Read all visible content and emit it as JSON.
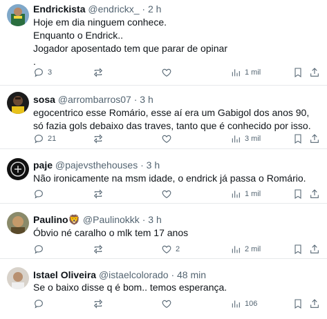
{
  "tweets": [
    {
      "name": "Endrickista",
      "handle": "@endrickx_",
      "sep": "·",
      "time": "2 h",
      "lines": [
        "Hoje em dia ninguem conhece.",
        "Enquanto o Endrick..",
        "Jogador aposentado tem que parar de opinar",
        "."
      ],
      "replies": "3",
      "retweets": "",
      "likes": "",
      "views": "1 mil",
      "avatar_color": "#2a6e3f"
    },
    {
      "name": "sosa",
      "handle": "@arrombarros07",
      "sep": "·",
      "time": "3 h",
      "lines": [
        "egocentrico esse Romário, esse aí era um Gabigol dos anos 90, só fazia gols debaixo das traves, tanto que é conhecido por isso."
      ],
      "replies": "21",
      "retweets": "",
      "likes": "",
      "views": "3 mil",
      "avatar_color": "#1c1c1c"
    },
    {
      "name": "paje",
      "handle": "@pajevsthehouses",
      "sep": "·",
      "time": "3 h",
      "lines": [
        "Não ironicamente na msm idade, o endrick já passa o Romário."
      ],
      "replies": "",
      "retweets": "",
      "likes": "",
      "views": "1 mil",
      "avatar_color": "#111111"
    },
    {
      "name": "Paulino",
      "name_emoji": "🦁",
      "handle": "@Paulinokkk",
      "sep": "·",
      "time": "3 h",
      "lines": [
        "Óbvio né caralho o mlk tem 17 anos"
      ],
      "replies": "",
      "retweets": "",
      "likes": "2",
      "views": "2 mil",
      "avatar_color": "#9a7a3a"
    },
    {
      "name": "Istael Oliveira",
      "handle": "@istaelcolorado",
      "sep": "·",
      "time": "48 min",
      "lines": [
        "Se o baixo disse q é bom.. temos esperança."
      ],
      "replies": "",
      "retweets": "",
      "likes": "",
      "views": "106",
      "avatar_color": "#c9c3bb"
    }
  ],
  "icons": {
    "reply": "reply-icon",
    "retweet": "retweet-icon",
    "like": "heart-icon",
    "views": "views-chart-icon",
    "bookmark": "bookmark-icon",
    "share": "share-icon"
  },
  "colors": {
    "text": "#0f1419",
    "muted": "#536471",
    "divider": "#e6e9eb"
  }
}
